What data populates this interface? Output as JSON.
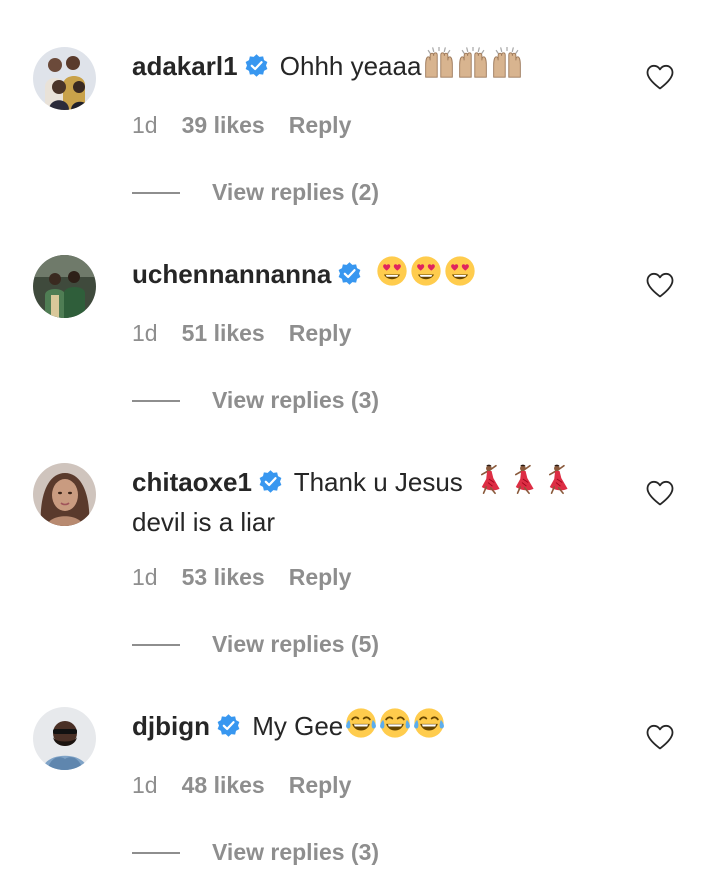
{
  "comments": [
    {
      "username": "adakarl1",
      "text": "Ohhh yeaaa",
      "text2": "",
      "emojis": [
        "raised-hands",
        "raised-hands",
        "raised-hands"
      ],
      "time": "1d",
      "likes": "39 likes",
      "reply": "Reply",
      "view_replies": "View replies (2)"
    },
    {
      "username": "uchennannanna",
      "text": "",
      "text2": "",
      "emojis": [
        "heart-eyes",
        "heart-eyes",
        "heart-eyes"
      ],
      "time": "1d",
      "likes": "51 likes",
      "reply": "Reply",
      "view_replies": "View replies (3)"
    },
    {
      "username": "chitaoxe1",
      "text": "Thank u Jesus",
      "text2": "devil is a liar",
      "emojis": [
        "dancer",
        "dancer",
        "dancer"
      ],
      "time": "1d",
      "likes": "53 likes",
      "reply": "Reply",
      "view_replies": "View replies (5)"
    },
    {
      "username": "djbign",
      "text": "My Gee",
      "text2": "",
      "emojis": [
        "tears-of-joy",
        "tears-of-joy",
        "tears-of-joy"
      ],
      "time": "1d",
      "likes": "48 likes",
      "reply": "Reply",
      "view_replies": "View replies (3)"
    }
  ],
  "icons": {
    "verified": "verified-badge-icon",
    "like": "heart-outline-icon"
  },
  "colors": {
    "text": "#262626",
    "secondary": "#8e8e8e",
    "verified": "#3897f0"
  }
}
